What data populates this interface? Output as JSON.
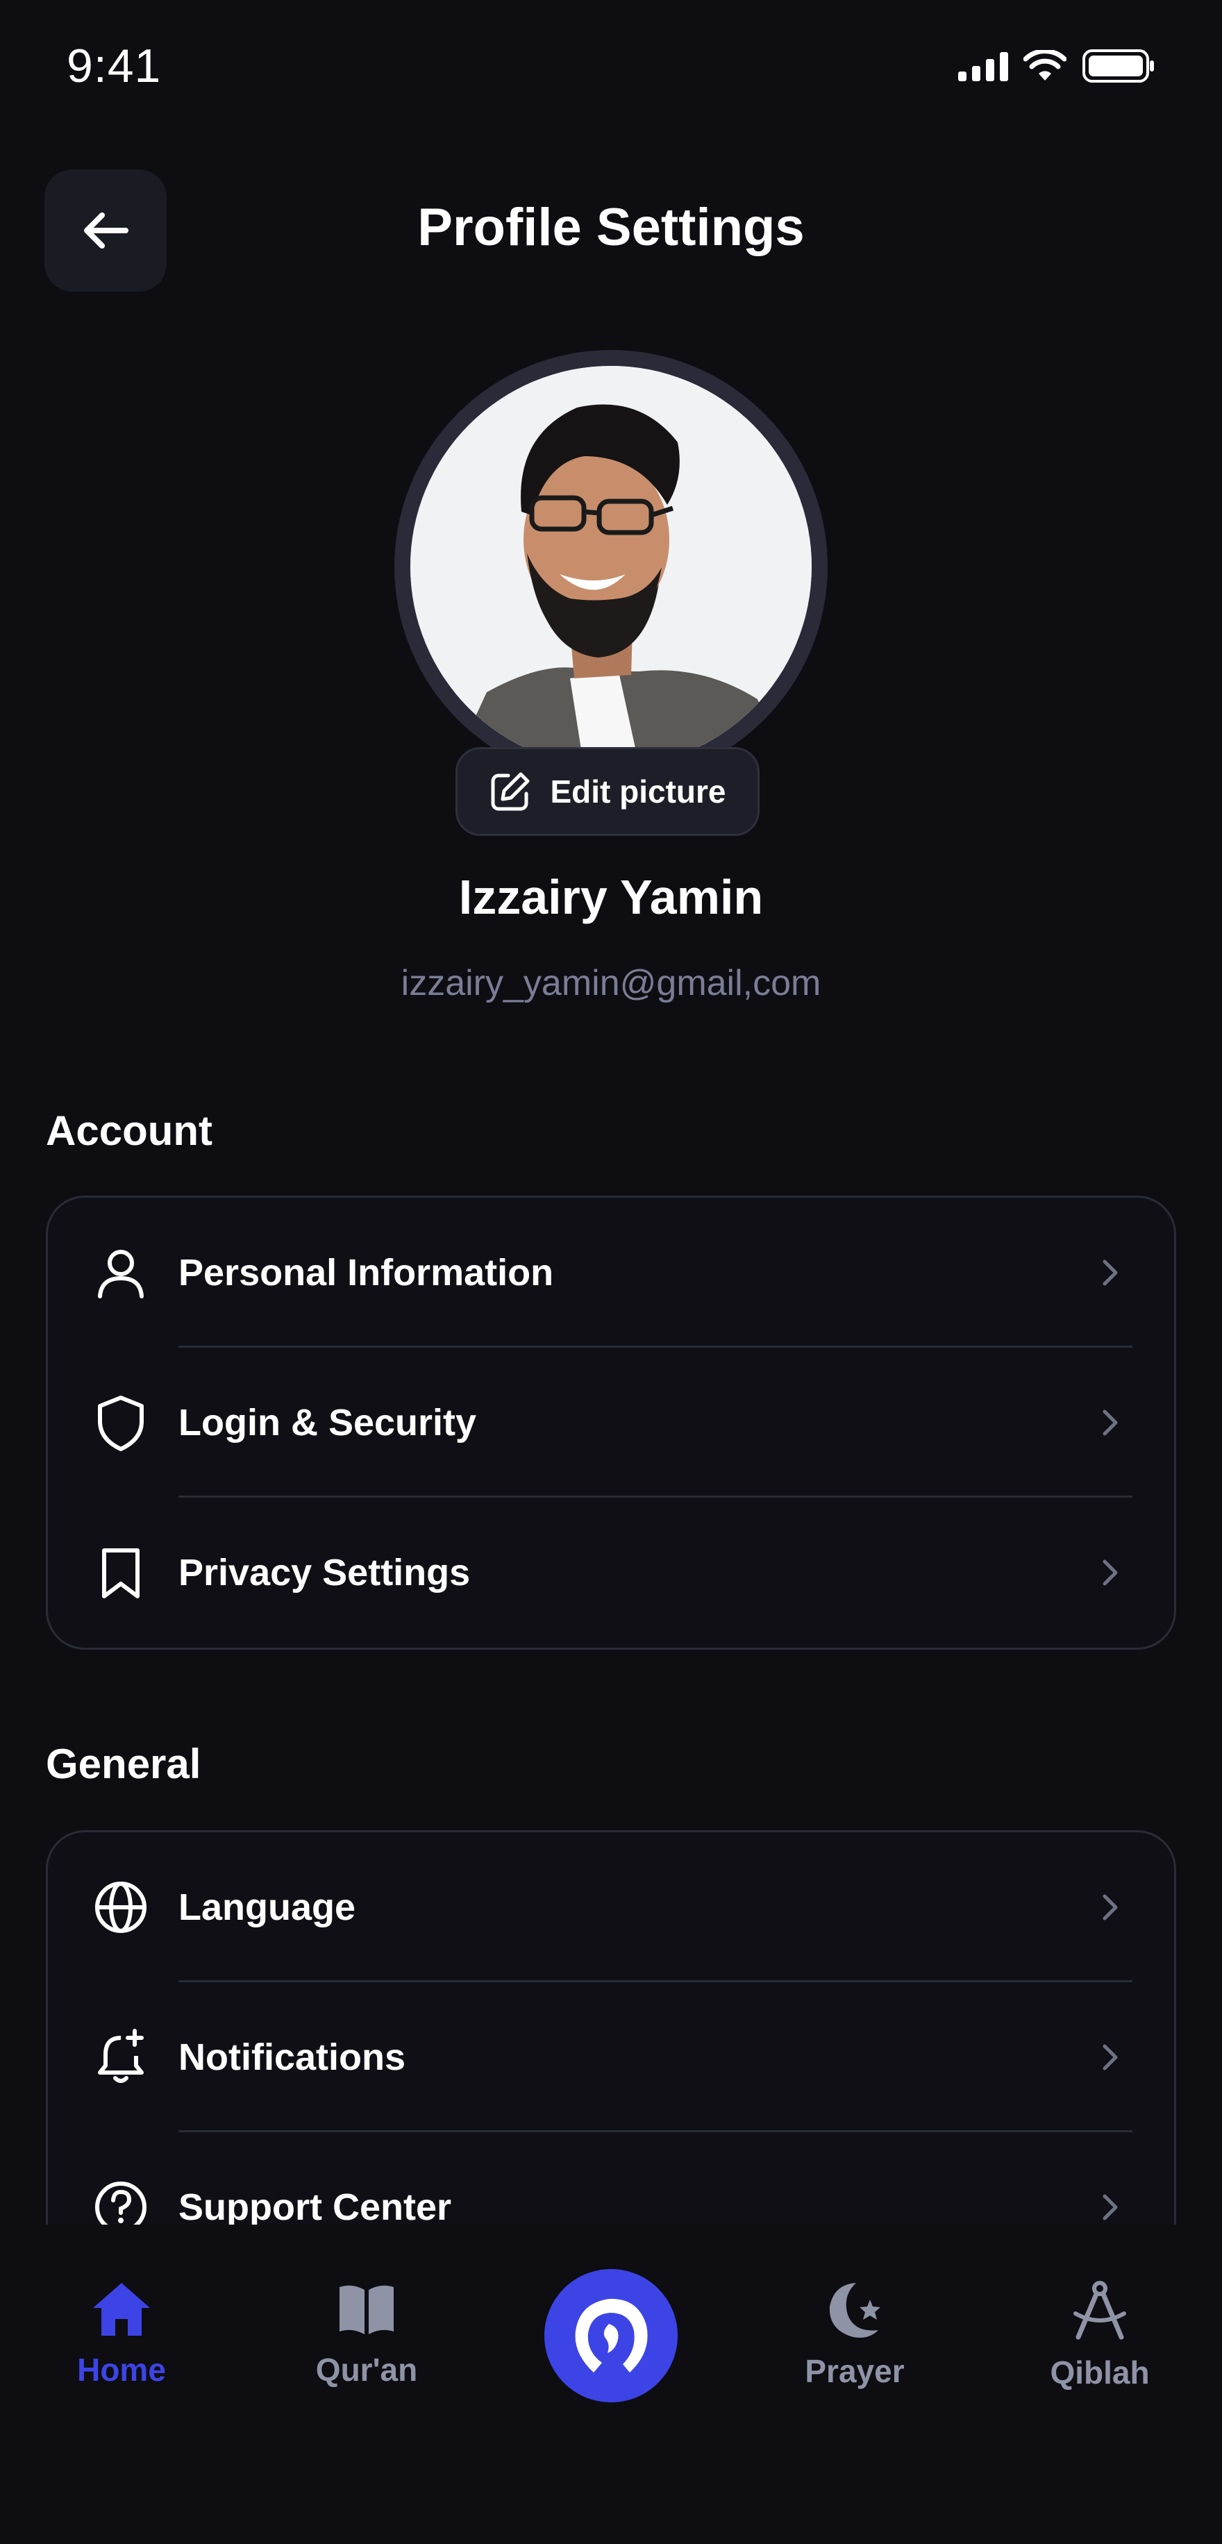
{
  "status_bar": {
    "time": "9:41"
  },
  "header": {
    "title": "Profile Settings"
  },
  "profile": {
    "edit_picture_label": "Edit picture",
    "name": "Izzairy Yamin",
    "email": "izzairy_yamin@gmail,com"
  },
  "account": {
    "title": "Account",
    "items": [
      {
        "label": "Personal Information",
        "icon": "user-icon"
      },
      {
        "label": "Login & Security",
        "icon": "shield-icon"
      },
      {
        "label": "Privacy Settings",
        "icon": "bookmark-icon"
      }
    ]
  },
  "general": {
    "title": "General",
    "items": [
      {
        "label": "Language",
        "icon": "globe-icon"
      },
      {
        "label": "Notifications",
        "icon": "bell-plus-icon"
      },
      {
        "label": "Support Center",
        "icon": "help-circle-icon"
      }
    ]
  },
  "bottom_nav": {
    "items": [
      {
        "label": "Home",
        "icon": "home-icon",
        "active": true
      },
      {
        "label": "Qur'an",
        "icon": "book-icon",
        "active": false
      },
      {
        "label": "Prayer",
        "icon": "moon-star-icon",
        "active": false
      },
      {
        "label": "Qiblah",
        "icon": "compass-icon",
        "active": false
      }
    ],
    "center_icon": "app-logo-icon"
  },
  "colors": {
    "background": "#0d0d12",
    "accent": "#3d44e6",
    "muted_text": "#7b7d96",
    "nav_inactive": "#8f93a6"
  }
}
